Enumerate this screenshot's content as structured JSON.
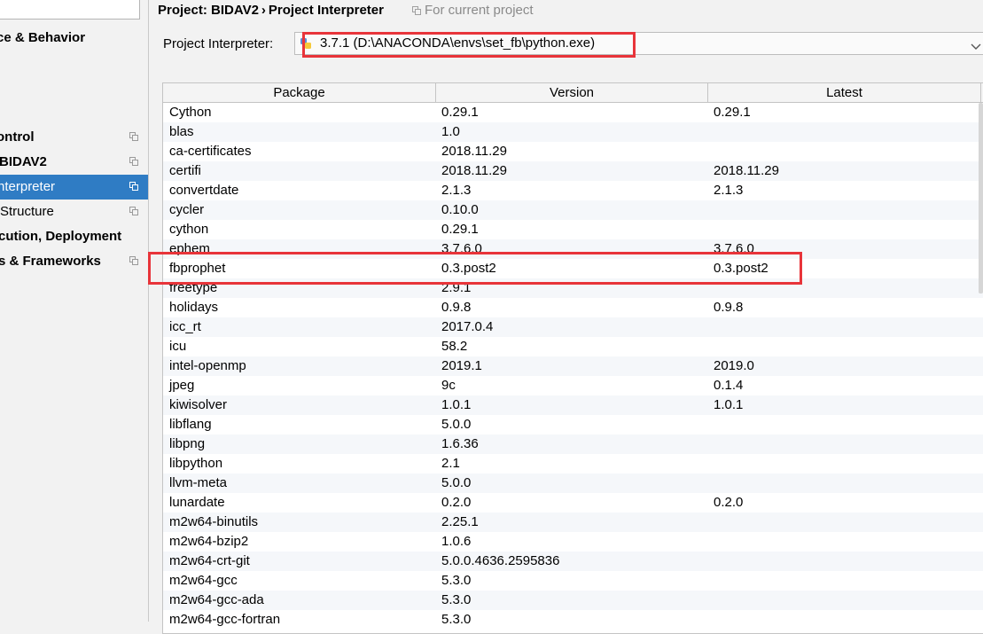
{
  "sidebar": {
    "items": [
      {
        "label": "ce & Behavior"
      },
      {
        "label": "ontrol"
      },
      {
        "label": "BIDAV2"
      },
      {
        "label": "nterpreter"
      },
      {
        "label": "Structure"
      },
      {
        "label": "cution, Deployment"
      },
      {
        "label": "s & Frameworks"
      }
    ]
  },
  "header": {
    "project": "Project: BIDAV2",
    "separator": "›",
    "page": "Project Interpreter",
    "scope_hint": "For current project"
  },
  "interpreter": {
    "label": "Project Interpreter:",
    "value": "3.7.1 (D:\\ANACONDA\\envs\\set_fb\\python.exe)"
  },
  "table": {
    "columns": [
      "Package",
      "Version",
      "Latest"
    ],
    "rows": [
      [
        "Cython",
        "0.29.1",
        "0.29.1"
      ],
      [
        "blas",
        "1.0",
        ""
      ],
      [
        "ca-certificates",
        "2018.11.29",
        ""
      ],
      [
        "certifi",
        "2018.11.29",
        "2018.11.29"
      ],
      [
        "convertdate",
        "2.1.3",
        "2.1.3"
      ],
      [
        "cycler",
        "0.10.0",
        ""
      ],
      [
        "cython",
        "0.29.1",
        ""
      ],
      [
        "ephem",
        "3.7.6.0",
        "3.7.6.0"
      ],
      [
        "fbprophet",
        "0.3.post2",
        "0.3.post2"
      ],
      [
        "freetype",
        "2.9.1",
        ""
      ],
      [
        "holidays",
        "0.9.8",
        "0.9.8"
      ],
      [
        "icc_rt",
        "2017.0.4",
        ""
      ],
      [
        "icu",
        "58.2",
        ""
      ],
      [
        "intel-openmp",
        "2019.1",
        "2019.0"
      ],
      [
        "jpeg",
        "9c",
        "0.1.4"
      ],
      [
        "kiwisolver",
        "1.0.1",
        "1.0.1"
      ],
      [
        "libflang",
        "5.0.0",
        ""
      ],
      [
        "libpng",
        "1.6.36",
        ""
      ],
      [
        "libpython",
        "2.1",
        ""
      ],
      [
        "llvm-meta",
        "5.0.0",
        ""
      ],
      [
        "lunardate",
        "0.2.0",
        "0.2.0"
      ],
      [
        "m2w64-binutils",
        "2.25.1",
        ""
      ],
      [
        "m2w64-bzip2",
        "1.0.6",
        ""
      ],
      [
        "m2w64-crt-git",
        "5.0.0.4636.2595836",
        ""
      ],
      [
        "m2w64-gcc",
        "5.3.0",
        ""
      ],
      [
        "m2w64-gcc-ada",
        "5.3.0",
        ""
      ],
      [
        "m2w64-gcc-fortran",
        "5.3.0",
        ""
      ]
    ]
  },
  "colors": {
    "selection": "#2f7cc4",
    "highlight_box": "#e8343a"
  },
  "icons": {
    "copy": "copy-icon",
    "python": "python-icon",
    "dropdown": "chevron-down-icon"
  }
}
